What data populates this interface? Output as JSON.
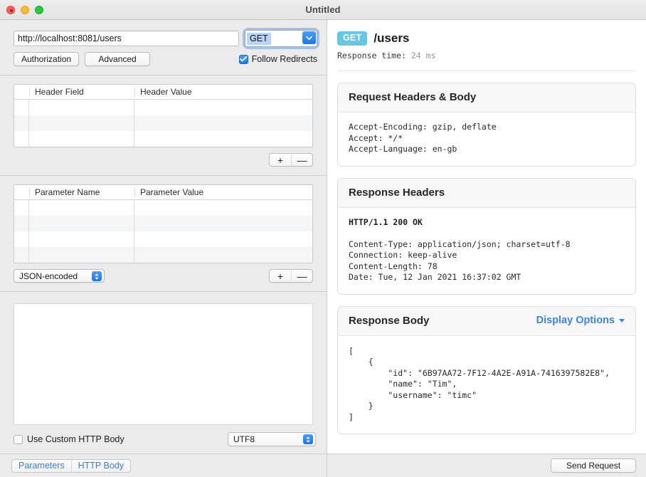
{
  "window": {
    "title": "Untitled"
  },
  "request": {
    "url": "http://localhost:8081/users",
    "url_placeholder": "http://",
    "method": "GET",
    "authorization_label": "Authorization",
    "advanced_label": "Advanced",
    "follow_redirects_label": "Follow Redirects",
    "follow_redirects_checked": true
  },
  "headers_table": {
    "columns": [
      "Header Field",
      "Header Value"
    ],
    "rows": [
      [
        "",
        ""
      ],
      [
        "",
        ""
      ],
      [
        "",
        ""
      ]
    ],
    "add_label": "+",
    "remove_label": "—"
  },
  "parameters_table": {
    "columns": [
      "Parameter Name",
      "Parameter Value"
    ],
    "rows": [
      [
        "",
        ""
      ],
      [
        "",
        ""
      ],
      [
        "",
        ""
      ],
      [
        "",
        ""
      ]
    ],
    "encoding_selected": "JSON-encoded",
    "add_label": "+",
    "remove_label": "—"
  },
  "custom_body": {
    "value": "",
    "checkbox_label": "Use Custom HTTP Body",
    "checkbox_checked": false,
    "charset_selected": "UTF8"
  },
  "left_tabs": {
    "items": [
      "Parameters",
      "HTTP Body"
    ]
  },
  "response": {
    "method": "GET",
    "method_badge_color": "#64c7e5",
    "path": "/users",
    "response_time_label": "Response time:",
    "response_time_value": "24 ms",
    "request_card": {
      "title": "Request Headers & Body",
      "lines": [
        "Accept-Encoding: gzip, deflate",
        "Accept: */*",
        "Accept-Language: en-gb"
      ]
    },
    "response_headers_card": {
      "title": "Response Headers",
      "status_line": "HTTP/1.1 200 OK",
      "lines": [
        "Content-Type: application/json; charset=utf-8",
        "Connection: keep-alive",
        "Content-Length: 78",
        "Date: Tue, 12 Jan 2021 16:37:02 GMT"
      ]
    },
    "response_body_card": {
      "title": "Response Body",
      "display_options_label": "Display Options",
      "body": "[\n    {\n        \"id\": \"6B97AA72-7F12-4A2E-A91A-7416397582E8\",\n        \"name\": \"Tim\",\n        \"username\": \"timc\"\n    }\n]"
    }
  },
  "footer": {
    "send_label": "Send Request"
  },
  "icons": {
    "chevron_down": "chevron-down-icon",
    "checkmark": "checkmark-icon",
    "stepper": "stepper-icon",
    "caret": "caret-down-icon"
  }
}
